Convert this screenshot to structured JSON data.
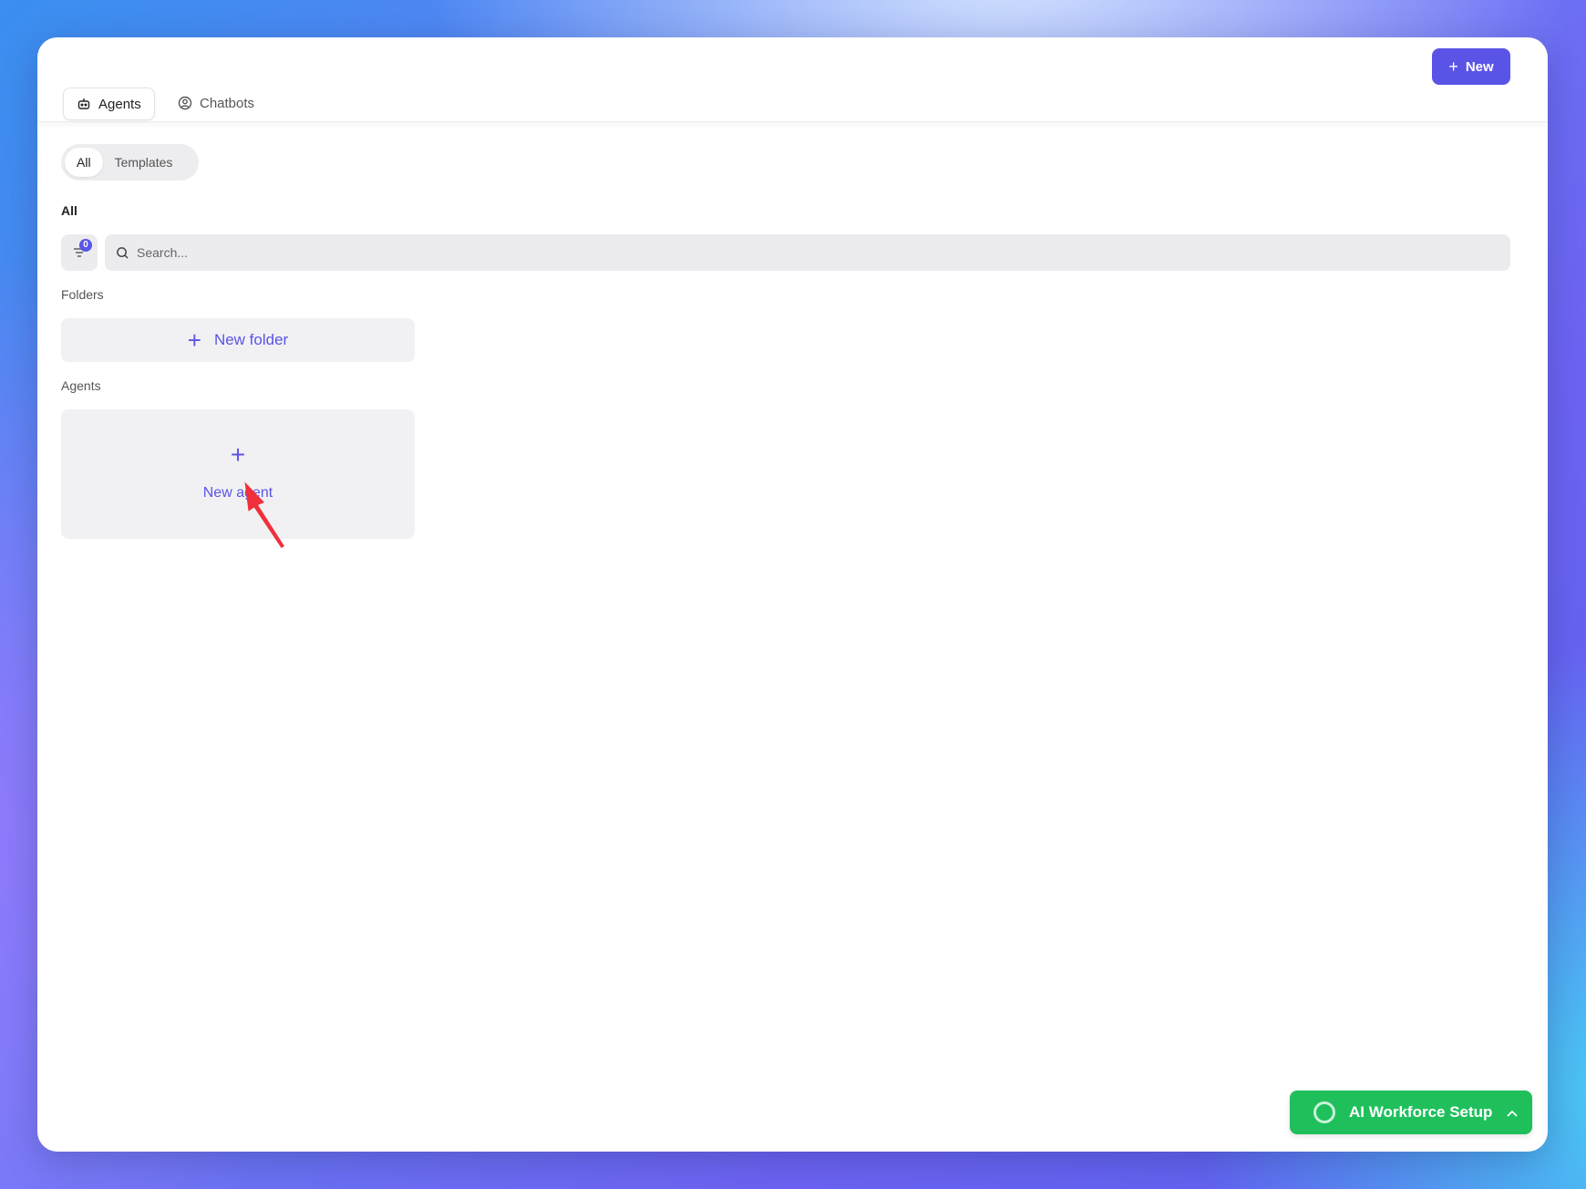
{
  "header": {
    "new_button_label": "New",
    "tabs": [
      {
        "label": "Agents",
        "icon": "robot-icon",
        "active": true
      },
      {
        "label": "Chatbots",
        "icon": "user-circle-icon",
        "active": false
      }
    ]
  },
  "filter_segment": {
    "items": [
      {
        "label": "All",
        "active": true
      },
      {
        "label": "Templates",
        "active": false
      }
    ]
  },
  "section_title": "All",
  "filter": {
    "badge_count": "0",
    "icon": "filter-icon"
  },
  "search": {
    "placeholder": "Search...",
    "value": ""
  },
  "folders": {
    "heading": "Folders",
    "new_folder_label": "New folder"
  },
  "agents": {
    "heading": "Agents",
    "new_agent_label": "New agent"
  },
  "setup_widget": {
    "label": "AI Workforce Setup",
    "icon": "chevron-up-icon"
  },
  "colors": {
    "accent": "#5a54e6",
    "success": "#1fc05c",
    "annotation_arrow": "#f0303a"
  }
}
